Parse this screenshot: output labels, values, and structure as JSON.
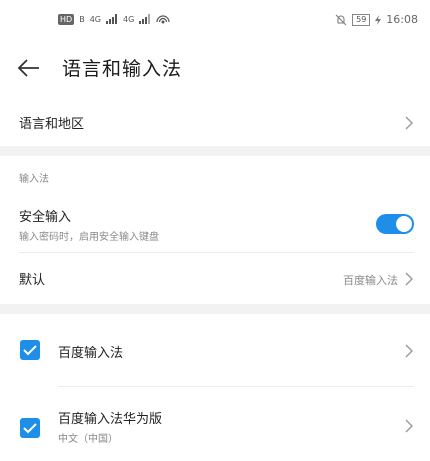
{
  "status": {
    "hd": "HD",
    "sim": "B",
    "sig1": "4G",
    "sig2": "4G",
    "battery": "59",
    "time": "16:08"
  },
  "header": {
    "title": "语言和输入法"
  },
  "language_region": {
    "label": "语言和地区"
  },
  "input_section": {
    "heading": "输入法"
  },
  "secure_input": {
    "label": "安全输入",
    "subtitle": "输入密码时，启用安全输入键盘",
    "enabled": true
  },
  "default_ime": {
    "label": "默认",
    "value": "百度输入法"
  },
  "imes": [
    {
      "label": "百度输入法",
      "subtitle": "",
      "checked": true
    },
    {
      "label": "百度输入法华为版",
      "subtitle": "中文（中国）",
      "checked": true
    }
  ],
  "colors": {
    "accent": "#1e8ee8",
    "band": "#f2f2f2"
  }
}
